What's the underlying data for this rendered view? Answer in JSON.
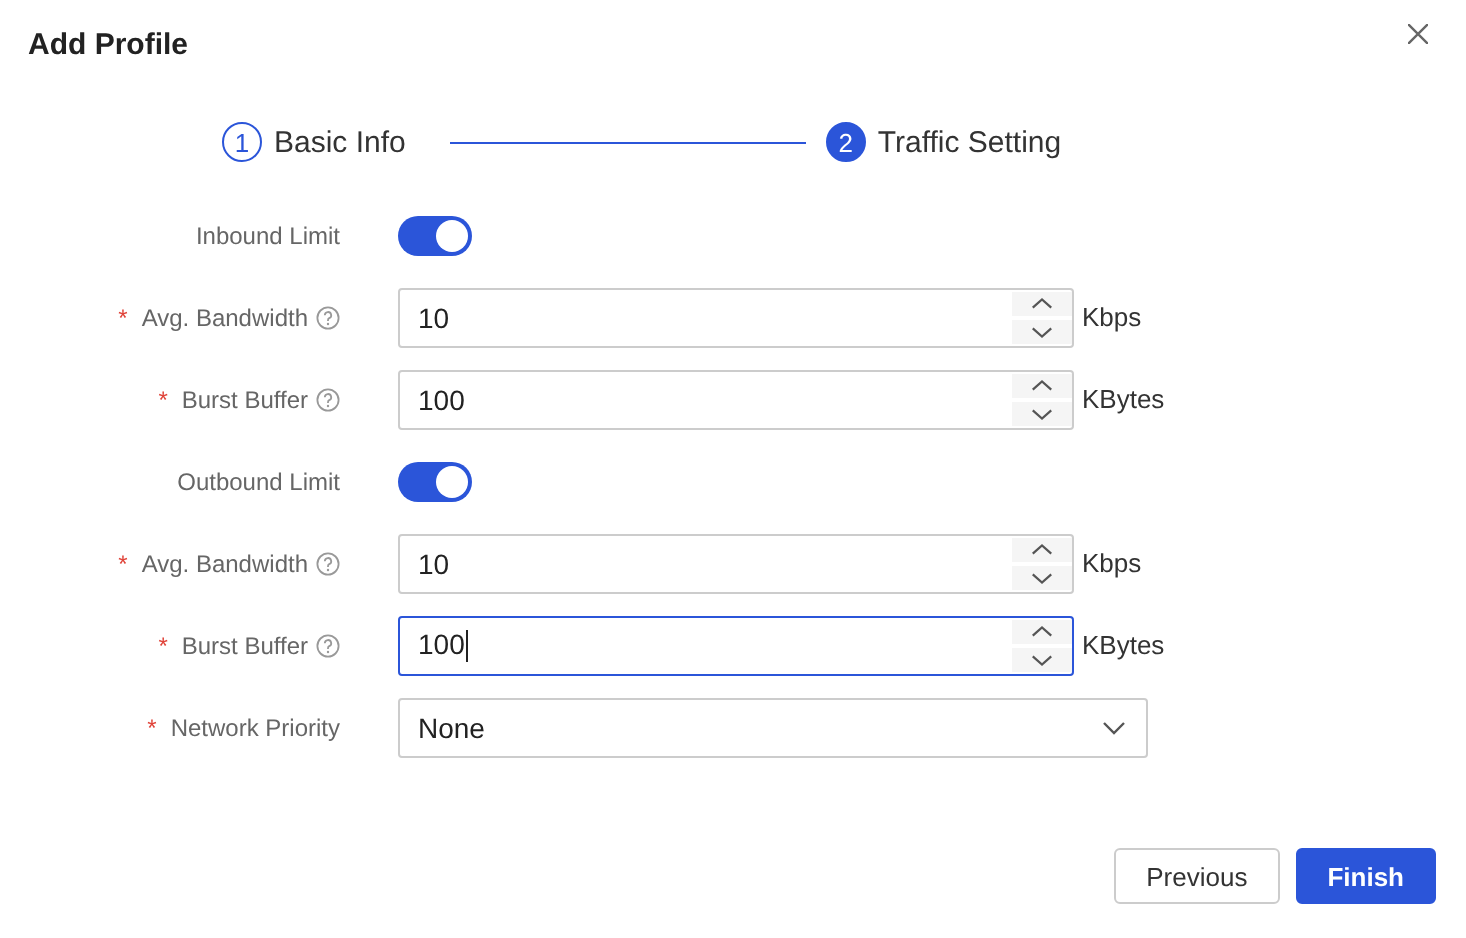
{
  "dialog": {
    "title": "Add Profile"
  },
  "steps": [
    {
      "number": "1",
      "label": "Basic Info",
      "selected": false
    },
    {
      "number": "2",
      "label": "Traffic Setting",
      "selected": true
    }
  ],
  "fields": [
    {
      "kind": "toggle",
      "label": "Inbound Limit",
      "on": true
    },
    {
      "kind": "number",
      "required_mark": "*",
      "label": "Avg. Bandwidth",
      "help": true,
      "value": "10",
      "unit": "Kbps",
      "focused": false
    },
    {
      "kind": "number",
      "required_mark": "*",
      "label": "Burst Buffer",
      "help": true,
      "value": "100",
      "unit": "KBytes",
      "focused": false
    },
    {
      "kind": "toggle",
      "label": "Outbound Limit",
      "on": true
    },
    {
      "kind": "number",
      "required_mark": "*",
      "label": "Avg. Bandwidth",
      "help": true,
      "value": "10",
      "unit": "Kbps",
      "focused": false
    },
    {
      "kind": "number",
      "required_mark": "*",
      "label": "Burst Buffer",
      "help": true,
      "value": "100",
      "unit": "KBytes",
      "focused": true
    },
    {
      "kind": "select",
      "required_mark": "*",
      "label": "Network Priority",
      "value": "None"
    }
  ],
  "buttons": [
    {
      "label": "Previous",
      "primary": false
    },
    {
      "label": "Finish",
      "primary": true
    }
  ]
}
